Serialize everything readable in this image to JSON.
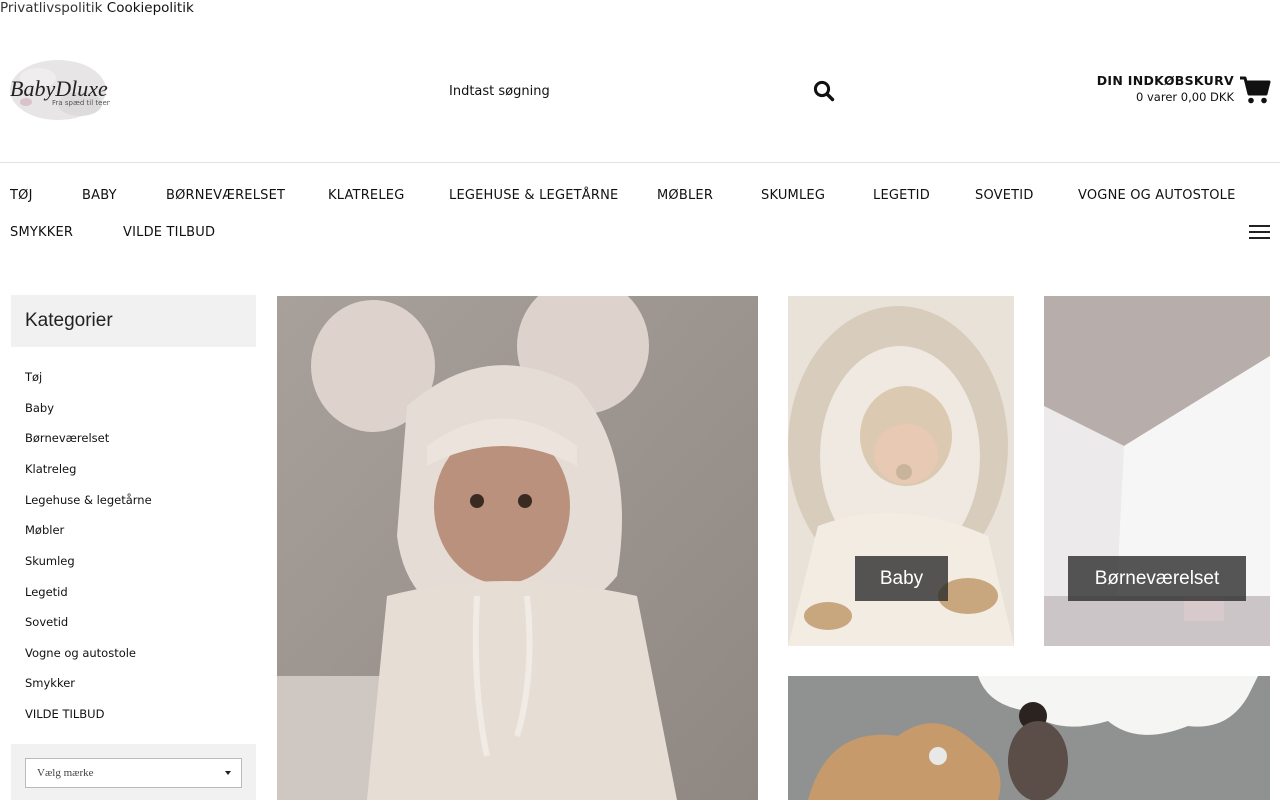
{
  "top_links": {
    "privacy": "Privatlivspolitik",
    "cookie": "Cookiepolitik"
  },
  "logo": {
    "name": "BabyDluxe",
    "tagline": "Fra spæd til teen"
  },
  "search": {
    "placeholder": "Indtast søgning",
    "icon": "search-icon"
  },
  "cart": {
    "title": "DIN INDKØBSKURV",
    "summary": "0 varer 0,00 DKK",
    "icon": "shopping-cart-icon"
  },
  "nav": {
    "items": [
      "TØJ",
      "BABY",
      "BØRNEVÆRELSET",
      "KLATRELEG",
      "LEGEHUSE & LEGETÅRNE",
      "MØBLER",
      "SKUMLEG",
      "LEGETID",
      "SOVETID",
      "VOGNE OG AUTOSTOLE",
      "SMYKKER",
      "VILDE TILBUD"
    ],
    "menu_icon": "hamburger-menu-icon"
  },
  "sidebar": {
    "title": "Kategorier",
    "items": [
      "Tøj",
      "Baby",
      "Børneværelset",
      "Klatreleg",
      "Legehuse & legetårne",
      "Møbler",
      "Skumleg",
      "Legetid",
      "Sovetid",
      "Vogne og autostole",
      "Smykker",
      "VILDE TILBUD"
    ],
    "brand_select": {
      "selected": "Vælg mærke"
    }
  },
  "tiles": {
    "baby_label": "Baby",
    "room_label": "Børneværelset"
  },
  "colors": {
    "text": "#111111",
    "panel": "#f1f1f1",
    "label_bg": "#2d2d2d"
  }
}
